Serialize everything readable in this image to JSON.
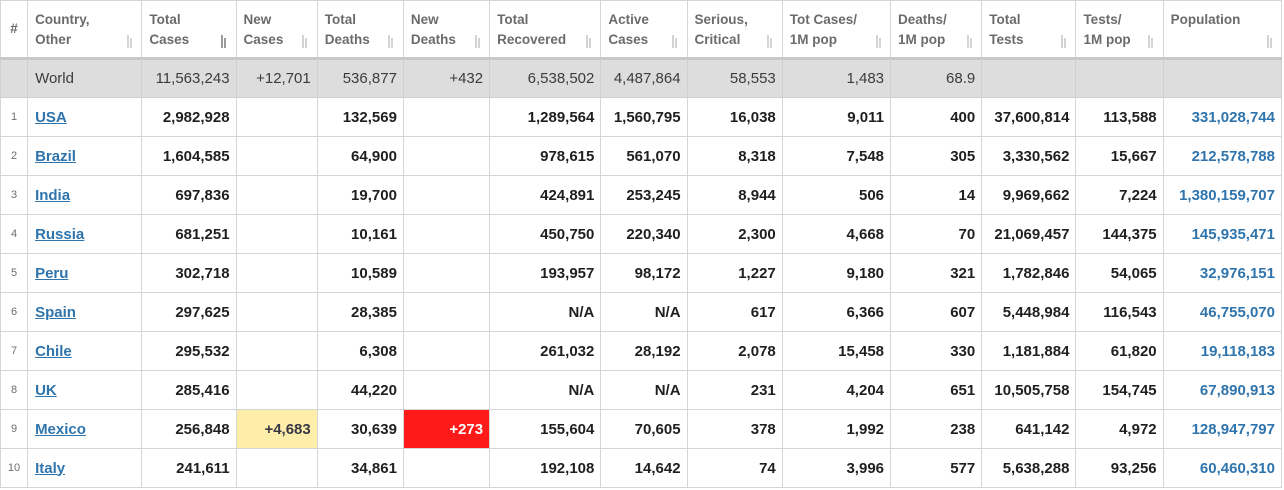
{
  "columns": [
    {
      "key": "idx",
      "label": "#"
    },
    {
      "key": "country",
      "label": "Country, Other"
    },
    {
      "key": "total_cases",
      "label": "Total Cases"
    },
    {
      "key": "new_cases",
      "label": "New Cases"
    },
    {
      "key": "total_deaths",
      "label": "Total Deaths"
    },
    {
      "key": "new_deaths",
      "label": "New Deaths"
    },
    {
      "key": "total_recovered",
      "label": "Total Recovered"
    },
    {
      "key": "active_cases",
      "label": "Active Cases"
    },
    {
      "key": "serious",
      "label": "Serious, Critical"
    },
    {
      "key": "cases_per_1m",
      "label": "Tot Cases/ 1M pop"
    },
    {
      "key": "deaths_per_1m",
      "label": "Deaths/ 1M pop"
    },
    {
      "key": "total_tests",
      "label": "Total Tests"
    },
    {
      "key": "tests_per_1m",
      "label": "Tests/ 1M pop"
    },
    {
      "key": "population",
      "label": "Population"
    }
  ],
  "sorted_column": "total_cases",
  "colors": {
    "link": "#2f74ac",
    "new_cases_highlight": "#ffeeaa",
    "new_deaths_highlight": "#ff1a1a",
    "world_row_bg": "#dddddd"
  },
  "world": {
    "country": "World",
    "total_cases": "11,563,243",
    "new_cases": "+12,701",
    "total_deaths": "536,877",
    "new_deaths": "+432",
    "total_recovered": "6,538,502",
    "active_cases": "4,487,864",
    "serious": "58,553",
    "cases_per_1m": "1,483",
    "deaths_per_1m": "68.9",
    "total_tests": "",
    "tests_per_1m": "",
    "population": ""
  },
  "rows": [
    {
      "idx": "1",
      "country": "USA",
      "total_cases": "2,982,928",
      "new_cases": "",
      "total_deaths": "132,569",
      "new_deaths": "",
      "total_recovered": "1,289,564",
      "active_cases": "1,560,795",
      "serious": "16,038",
      "cases_per_1m": "9,011",
      "deaths_per_1m": "400",
      "total_tests": "37,600,814",
      "tests_per_1m": "113,588",
      "population": "331,028,744"
    },
    {
      "idx": "2",
      "country": "Brazil",
      "total_cases": "1,604,585",
      "new_cases": "",
      "total_deaths": "64,900",
      "new_deaths": "",
      "total_recovered": "978,615",
      "active_cases": "561,070",
      "serious": "8,318",
      "cases_per_1m": "7,548",
      "deaths_per_1m": "305",
      "total_tests": "3,330,562",
      "tests_per_1m": "15,667",
      "population": "212,578,788"
    },
    {
      "idx": "3",
      "country": "India",
      "total_cases": "697,836",
      "new_cases": "",
      "total_deaths": "19,700",
      "new_deaths": "",
      "total_recovered": "424,891",
      "active_cases": "253,245",
      "serious": "8,944",
      "cases_per_1m": "506",
      "deaths_per_1m": "14",
      "total_tests": "9,969,662",
      "tests_per_1m": "7,224",
      "population": "1,380,159,707"
    },
    {
      "idx": "4",
      "country": "Russia",
      "total_cases": "681,251",
      "new_cases": "",
      "total_deaths": "10,161",
      "new_deaths": "",
      "total_recovered": "450,750",
      "active_cases": "220,340",
      "serious": "2,300",
      "cases_per_1m": "4,668",
      "deaths_per_1m": "70",
      "total_tests": "21,069,457",
      "tests_per_1m": "144,375",
      "population": "145,935,471"
    },
    {
      "idx": "5",
      "country": "Peru",
      "total_cases": "302,718",
      "new_cases": "",
      "total_deaths": "10,589",
      "new_deaths": "",
      "total_recovered": "193,957",
      "active_cases": "98,172",
      "serious": "1,227",
      "cases_per_1m": "9,180",
      "deaths_per_1m": "321",
      "total_tests": "1,782,846",
      "tests_per_1m": "54,065",
      "population": "32,976,151"
    },
    {
      "idx": "6",
      "country": "Spain",
      "total_cases": "297,625",
      "new_cases": "",
      "total_deaths": "28,385",
      "new_deaths": "",
      "total_recovered": "N/A",
      "active_cases": "N/A",
      "serious": "617",
      "cases_per_1m": "6,366",
      "deaths_per_1m": "607",
      "total_tests": "5,448,984",
      "tests_per_1m": "116,543",
      "population": "46,755,070"
    },
    {
      "idx": "7",
      "country": "Chile",
      "total_cases": "295,532",
      "new_cases": "",
      "total_deaths": "6,308",
      "new_deaths": "",
      "total_recovered": "261,032",
      "active_cases": "28,192",
      "serious": "2,078",
      "cases_per_1m": "15,458",
      "deaths_per_1m": "330",
      "total_tests": "1,181,884",
      "tests_per_1m": "61,820",
      "population": "19,118,183"
    },
    {
      "idx": "8",
      "country": "UK",
      "total_cases": "285,416",
      "new_cases": "",
      "total_deaths": "44,220",
      "new_deaths": "",
      "total_recovered": "N/A",
      "active_cases": "N/A",
      "serious": "231",
      "cases_per_1m": "4,204",
      "deaths_per_1m": "651",
      "total_tests": "10,505,758",
      "tests_per_1m": "154,745",
      "population": "67,890,913"
    },
    {
      "idx": "9",
      "country": "Mexico",
      "total_cases": "256,848",
      "new_cases": "+4,683",
      "total_deaths": "30,639",
      "new_deaths": "+273",
      "total_recovered": "155,604",
      "active_cases": "70,605",
      "serious": "378",
      "cases_per_1m": "1,992",
      "deaths_per_1m": "238",
      "total_tests": "641,142",
      "tests_per_1m": "4,972",
      "population": "128,947,797"
    },
    {
      "idx": "10",
      "country": "Italy",
      "total_cases": "241,611",
      "new_cases": "",
      "total_deaths": "34,861",
      "new_deaths": "",
      "total_recovered": "192,108",
      "active_cases": "14,642",
      "serious": "74",
      "cases_per_1m": "3,996",
      "deaths_per_1m": "577",
      "total_tests": "5,638,288",
      "tests_per_1m": "93,256",
      "population": "60,460,310"
    }
  ]
}
